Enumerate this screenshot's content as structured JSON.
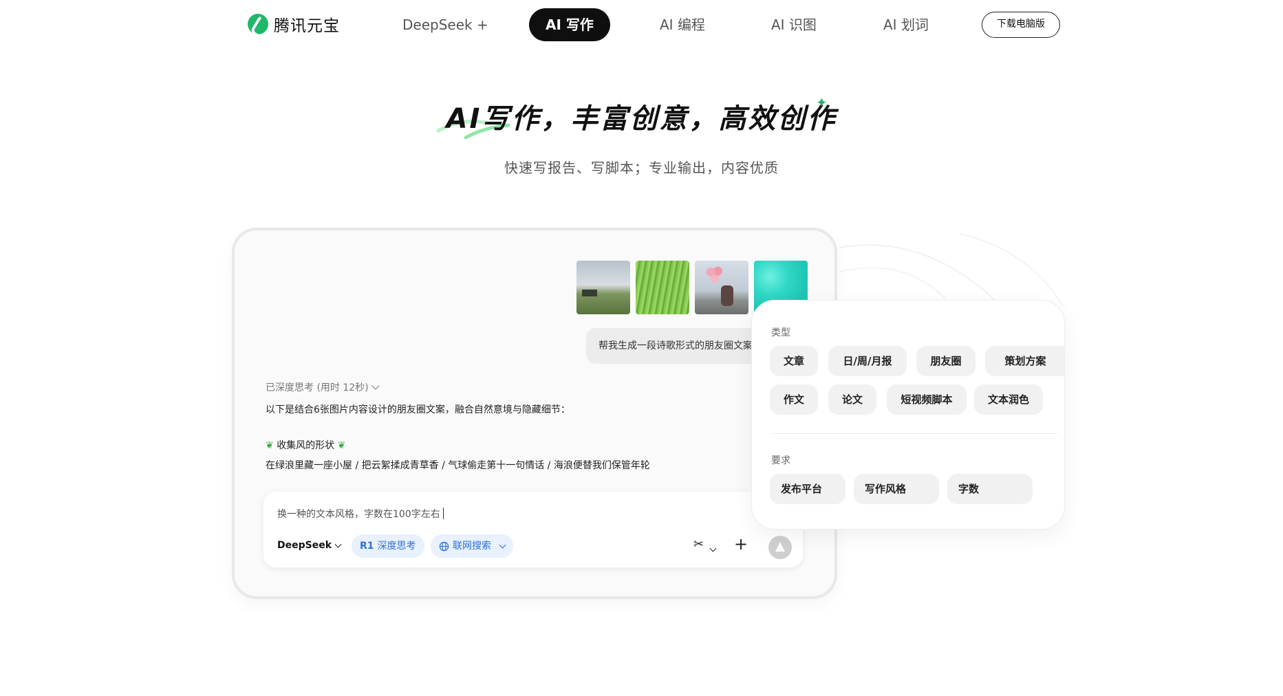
{
  "nav": {
    "logo_text": "腾讯元宝",
    "items": [
      {
        "label": "DeepSeek +"
      },
      {
        "label": "AI 写作"
      },
      {
        "label": "AI 编程"
      },
      {
        "label": "AI 识图"
      },
      {
        "label": "AI 划词"
      }
    ],
    "download_label": "下载电脑版"
  },
  "hero": {
    "title": "AI写作，丰富创意，高效创作",
    "subtitle": "快速写报告、写脚本；专业输出，内容优质"
  },
  "chat": {
    "user_message": "帮我生成一段诗歌形式的朋友圈文案",
    "thinking_label": "已深度思考 (用时 12秒)",
    "answer_intro": "以下是结合6张图片内容设计的朋友圈文案，融合自然意境与隐藏细节：",
    "poem_title": "收集风的形状",
    "poem_line": "在绿浪里藏一座小屋 / 把云絮揉成青草香 / 气球偷走第十一句情话 / 海浪便替我们保管年轮"
  },
  "input": {
    "value": "换一种的文本风格，字数在100字左右",
    "model": "DeepSeek",
    "deep_think": "深度思考",
    "web_search": "联网搜索"
  },
  "options": {
    "type_label": "类型",
    "types": [
      "文章",
      "日/周/月报",
      "朋友圈",
      "策划方案",
      "作文",
      "论文",
      "短视频脚本",
      "文本润色"
    ],
    "req_label": "要求",
    "requirements": [
      "发布平台",
      "写作风格",
      "字数"
    ]
  },
  "colors": {
    "brand_green": "#1fb86a",
    "chip_blue": "#2f6fdd",
    "nav_active_bg": "#0f0f0f"
  }
}
